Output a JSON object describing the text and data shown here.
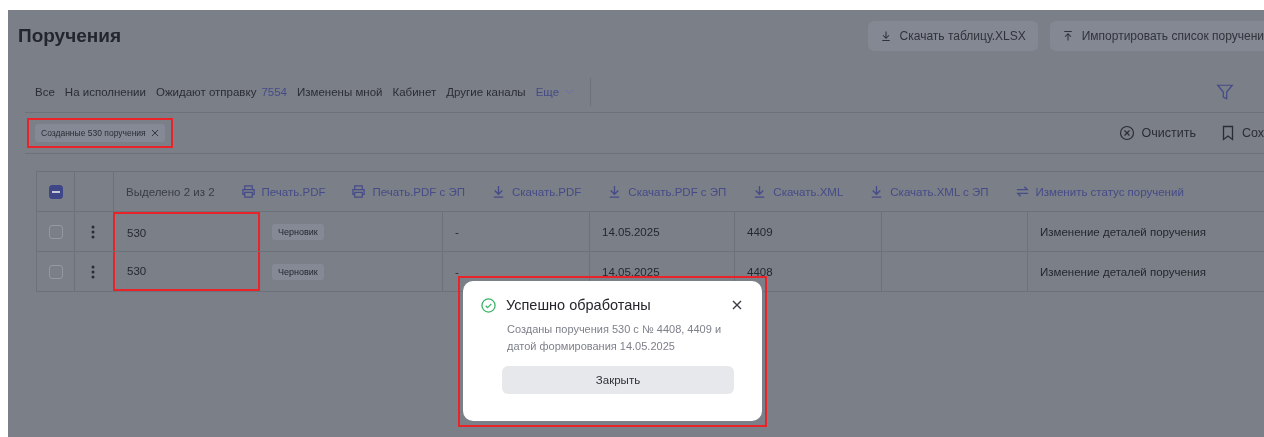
{
  "page": {
    "title": "Поручения"
  },
  "header_buttons": [
    {
      "label": "Скачать таблицу.XLSX"
    },
    {
      "label": "Импортировать список поручени"
    }
  ],
  "tabs": [
    {
      "label": "Все"
    },
    {
      "label": "На исполнении"
    },
    {
      "label": "Ожидают отправку",
      "count": "7554"
    },
    {
      "label": "Изменены мной"
    },
    {
      "label": "Кабинет"
    },
    {
      "label": "Другие каналы"
    }
  ],
  "more_tab": {
    "label": "Еще"
  },
  "filter_chips": [
    {
      "label": "Созданные 530 поручения"
    }
  ],
  "filter_actions": [
    {
      "label": "Очистить"
    },
    {
      "label": "Сох"
    }
  ],
  "table": {
    "select_all": {
      "indeterminate": true
    },
    "selection_text": "Выделено 2 из 2",
    "actions": [
      {
        "label": "Печать.PDF"
      },
      {
        "label": "Печать.PDF с ЭП"
      },
      {
        "label": "Скачать.PDF"
      },
      {
        "label": "Скачать.PDF с ЭП"
      },
      {
        "label": "Скачать.XML"
      },
      {
        "label": "Скачать.XML с ЭП"
      },
      {
        "label": "Изменить статус поручений"
      }
    ],
    "rows": [
      {
        "checked": false,
        "column_1": "530",
        "column_2": "Черновик",
        "column_3": "-",
        "column_4": "14.05.2025",
        "column_5": "4409",
        "column_7": "Изменение деталей поручения"
      },
      {
        "checked": false,
        "column_1": "530",
        "column_2": "Черновик",
        "column_3": "-",
        "column_4": "14.05.2025",
        "column_5": "4408",
        "column_7": "Изменение деталей поручения"
      }
    ]
  },
  "dialog": {
    "title": "Успешно обработаны",
    "message": "Созданы поручения 530 с № 4408, 4409 и датой формирования 14.05.2025",
    "button": "Закрыть"
  }
}
